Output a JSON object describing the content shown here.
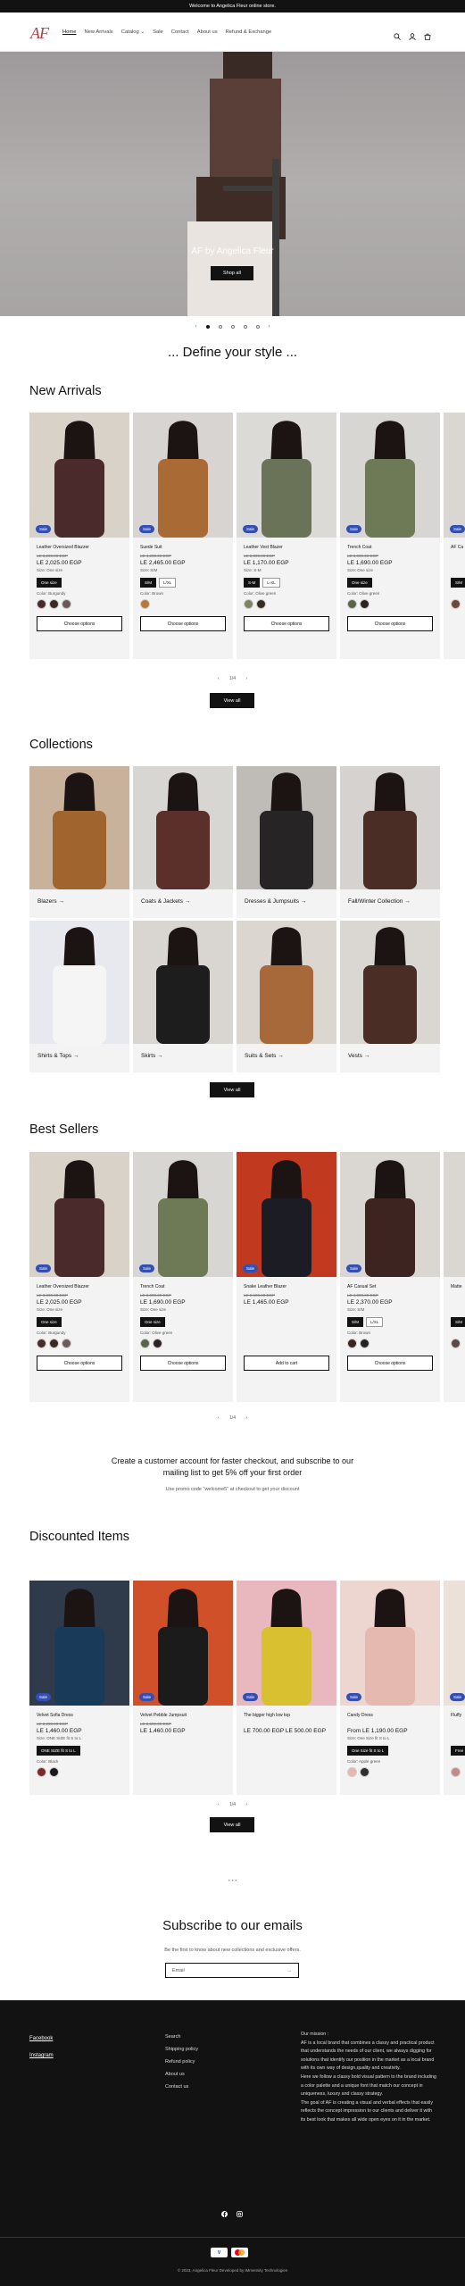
{
  "announcement": "Welcome to Angelica Fleur online store.",
  "header": {
    "logo": "AF",
    "nav": [
      "Home",
      "New Arrivals",
      "Catalog ⌄",
      "Sale",
      "Contact",
      "About us",
      "Refund & Exchange"
    ],
    "icons": [
      "search-icon",
      "account-icon",
      "cart-icon"
    ]
  },
  "hero": {
    "title": "AF by Angelica Fleur",
    "button": "Shop all",
    "slide_controls": {
      "prev": "‹",
      "next": "›",
      "total_slides": 5,
      "active": 1
    }
  },
  "tagline": "... Define your style ...",
  "new_arrivals": {
    "heading": "New Arrivals",
    "products": [
      {
        "title": "Leather Oversized Blazzer",
        "badge": "Sale",
        "old": "LE 3,200.00 EGP",
        "price": "LE 2,025.00 EGP",
        "sub": "Size: One size",
        "sizes": [
          "One size"
        ],
        "selected": 0,
        "color_label": "Color: Burgundy",
        "swatches": [
          "#4b2a2a",
          "#3a2b22",
          "#6b5a55"
        ],
        "button": "Choose options"
      },
      {
        "title": "Suede Suit",
        "badge": "Sale",
        "old": "LE 4,200.00 EGP",
        "price": "LE 2,465.00 EGP",
        "sub": "Size: S/M",
        "sizes": [
          "S/M",
          "L/XL"
        ],
        "selected": 0,
        "color_label": "Color: Brown",
        "swatches": [
          "#b7773b"
        ],
        "button": "Choose options"
      },
      {
        "title": "Leather Vest Blazer",
        "badge": "Sale",
        "old": "LE 2,000.00 EGP",
        "price": "LE 1,170.00 EGP",
        "sub": "Size: S-M",
        "sizes": [
          "S-M",
          "L-XL"
        ],
        "selected": 0,
        "color_label": "Color: Olive green",
        "swatches": [
          "#7c8462",
          "#3b2a22"
        ],
        "button": "Choose options"
      },
      {
        "title": "Trench Coat",
        "badge": "Sale",
        "old": "LE 3,000.00 EGP",
        "price": "LE 1,690.00 EGP",
        "sub": "Size: One size",
        "sizes": [
          "One size"
        ],
        "selected": 0,
        "color_label": "Color: Olive green",
        "swatches": [
          "#5b6447",
          "#2d2220"
        ],
        "button": "Choose options"
      },
      {
        "title": "AF Casual",
        "badge": "Sale",
        "old": "",
        "price": "",
        "sub": "",
        "sizes": [
          "S/M"
        ],
        "selected": 0,
        "color_label": "",
        "swatches": [
          "#6b4a3a"
        ],
        "button": ""
      }
    ],
    "pager": "‹ 1/4 ›",
    "view_all": "View all"
  },
  "collections": {
    "heading": "Collections",
    "items": [
      "Blazers →",
      "Coats & Jackets →",
      "Dresses & Jumpsuits →",
      "Fall/Winter Collection →",
      "Shirts & Tops →",
      "Skirts →",
      "Suits & Sets →",
      "Vests →"
    ],
    "view_all": "View all"
  },
  "best_sellers": {
    "heading": "Best Sellers",
    "products": [
      {
        "title": "Leather Oversized Blazzer",
        "badge": "Sale",
        "old": "LE 3,000.00 EGP",
        "price": "LE 2,025.00 EGP",
        "sub": "Size: One size",
        "sizes": [
          "One size"
        ],
        "selected": 0,
        "color_label": "Color: Burgundy",
        "swatches": [
          "#4b2a2a",
          "#3a2b22",
          "#6b5a55"
        ],
        "button": "Choose options"
      },
      {
        "title": "Trench Coat",
        "badge": "Sale",
        "old": "LE 3,000.00 EGP",
        "price": "LE 1,690.00 EGP",
        "sub": "Size: One size",
        "sizes": [
          "One size"
        ],
        "selected": 0,
        "color_label": "Color: Olive green",
        "swatches": [
          "#5b6447",
          "#2d2220"
        ],
        "button": "Choose options"
      },
      {
        "title": "Snake Leather Blazer",
        "badge": "Sale",
        "old": "LE 2,500.00 EGP",
        "price": "LE 1,465.00 EGP",
        "sub": "",
        "sizes": [],
        "selected": -1,
        "color_label": "",
        "swatches": [],
        "button": "Add to cart"
      },
      {
        "title": "AF Casual Set",
        "badge": "Sale",
        "old": "LE 4,000.00 EGP",
        "price": "LE 2,370.00 EGP",
        "sub": "Size: S/M",
        "sizes": [
          "S/M",
          "L/XL"
        ],
        "selected": 0,
        "color_label": "Color: Brown",
        "swatches": [
          "#3a2620",
          "#222"
        ],
        "button": "Choose options"
      },
      {
        "title": "Matte Leather",
        "badge": "",
        "old": "",
        "price": "",
        "sub": "",
        "sizes": [
          "S/M"
        ],
        "selected": 0,
        "color_label": "",
        "swatches": [
          "#5a4a42"
        ],
        "button": ""
      }
    ],
    "pager": "‹ 1/4 ›"
  },
  "promo": {
    "line": "Create a customer account for faster checkout, and subscribe to our mailing list to get 5% off your first order",
    "note": "Use promo code \"welcome5\" at checkout to get your discount"
  },
  "discounted": {
    "heading": "Discounted Items",
    "products": [
      {
        "title": "Velvet Sofia Dress",
        "badge": "Sale",
        "old": "LE 2,200.00 EGP",
        "price": "LE 1,460.00 EGP",
        "sub": "Size: ONE SIZE fit S to L",
        "sizes": [
          "ONE SIZE fit S to L"
        ],
        "selected": 0,
        "color_label": "Color: Black",
        "swatches": [
          "#7b2a2a",
          "#1a1a1a"
        ],
        "button": ""
      },
      {
        "title": "Velvet Pebble Jumpsuit",
        "badge": "Sale",
        "old": "LE 2,500.00 EGP",
        "price": "LE 1,460.00 EGP",
        "sub": "",
        "sizes": [],
        "selected": -1,
        "color_label": "",
        "swatches": [],
        "button": ""
      },
      {
        "title": "The bigger high low top",
        "badge": "Sale",
        "old": "",
        "price": "LE 700.00 EGP  LE 500.00 EGP",
        "sub": "",
        "sizes": [],
        "selected": -1,
        "color_label": "",
        "swatches": [],
        "button": ""
      },
      {
        "title": "Candy Dress",
        "badge": "Sale",
        "old": "",
        "price": "From LE 1,190.00 EGP",
        "sub": "Size: One Size fit S to L",
        "sizes": [
          "One Size fit S to L"
        ],
        "selected": 0,
        "color_label": "Color: Apple green",
        "swatches": [
          "#e8b7b0",
          "#2d2d2d"
        ],
        "button": ""
      },
      {
        "title": "Fluffy",
        "badge": "Sale",
        "old": "",
        "price": "",
        "sub": "",
        "sizes": [
          "Free"
        ],
        "selected": 0,
        "color_label": "",
        "swatches": [
          "#c48a8a"
        ],
        "button": ""
      }
    ],
    "pager": "‹ 1/4 ›",
    "view_all": "View all",
    "more": "• • •"
  },
  "subscribe": {
    "heading": "Subscribe to our emails",
    "sub": "Be the first to know about new collections and exclusive offers.",
    "placeholder": "Email",
    "arrow": "→"
  },
  "footer": {
    "social": [
      "Facebook",
      "Instagram"
    ],
    "links": [
      "Search",
      "Shipping policy",
      "Refund policy",
      "About us",
      "Contact us"
    ],
    "mission_title": "Our mission :",
    "mission": "AF is a local brand that combines a classy and practical product that understands the needs of our client, we always digging for solutions that identify our position in the market as a local brand with its own way of design,quality and creativity.\nHere we follow a classy bold visual pattern to the brand including a color palette and a unique font that match our concept in uniqueness, luxury and classy strategy.\nThe goal of AF is creating a visual and verbal effects that easily reflects the concept impression to our clients and deliver it with its best look that makes all wide open eyes on it in the market.",
    "copyright": "© 2023, Angelica Fleur Developed by iMmensity Technologies"
  }
}
